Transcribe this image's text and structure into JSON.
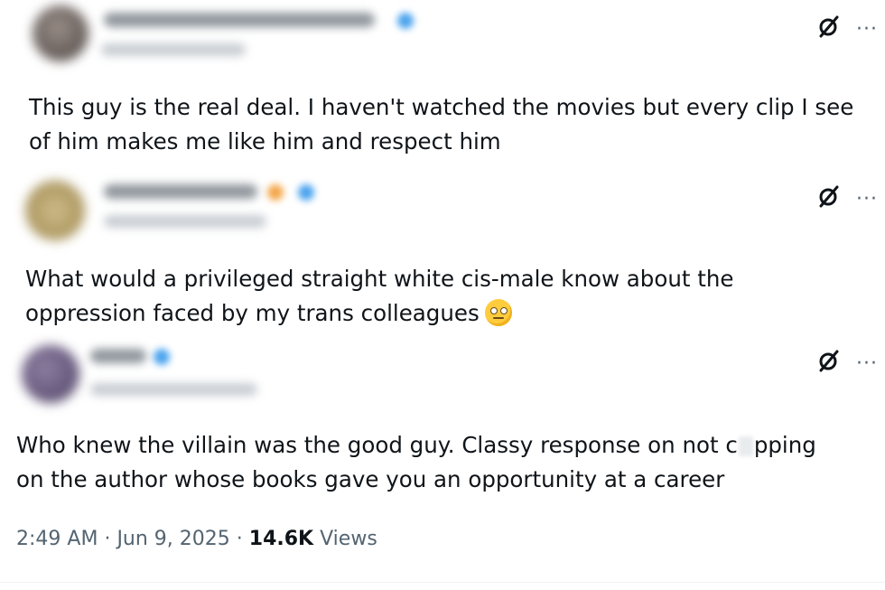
{
  "posts": [
    {
      "text": "This guy is the real deal. I haven't watched the movies but every clip I see of him makes me like him and respect him",
      "line1": "This guy is the real deal. I haven't watched the movies but every clip I see",
      "line2": "of him makes me like him and respect him"
    },
    {
      "line1": "What would a privileged straight white cis-male know about the",
      "line2": "oppression faced by my trans colleagues",
      "emoji": "face-with-rolling-eyes"
    },
    {
      "line1_a": "Who knew the villain was the good guy. Classy response on not c",
      "line1_b": "pping",
      "line2": "on the author whose books gave you an opportunity at a career"
    }
  ],
  "meta": {
    "time": "2:49 AM",
    "sep1": "·",
    "date": "Jun 9, 2025",
    "sep2": "·",
    "views_count": "14.6K",
    "views_label": "Views"
  },
  "icons": {
    "grok": "grok-icon",
    "more": "more-options-icon"
  },
  "colors": {
    "text": "#0f1419",
    "secondary": "#536471",
    "verified": "#1d9bf0"
  }
}
